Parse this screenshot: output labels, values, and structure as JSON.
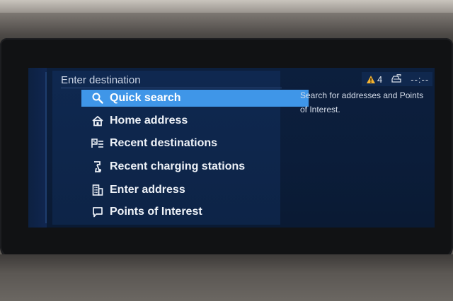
{
  "header": {
    "title": "Enter destination"
  },
  "status": {
    "warning_count": "4",
    "clock": "--:--"
  },
  "menu": {
    "items": [
      {
        "label": "Quick search",
        "icon": "search-icon",
        "selected": true
      },
      {
        "label": "Home address",
        "icon": "home-icon",
        "selected": false
      },
      {
        "label": "Recent destinations",
        "icon": "recent-destinations-icon",
        "selected": false
      },
      {
        "label": "Recent charging stations",
        "icon": "charging-station-icon",
        "selected": false
      },
      {
        "label": "Enter address",
        "icon": "address-icon",
        "selected": false
      },
      {
        "label": "Points of Interest",
        "icon": "poi-icon",
        "selected": false
      }
    ]
  },
  "help": {
    "text": "Search for addresses and Points of Interest."
  },
  "colors": {
    "selection": "#3f96e8",
    "background": "#0c1f3d",
    "warning": "#f2b233"
  }
}
